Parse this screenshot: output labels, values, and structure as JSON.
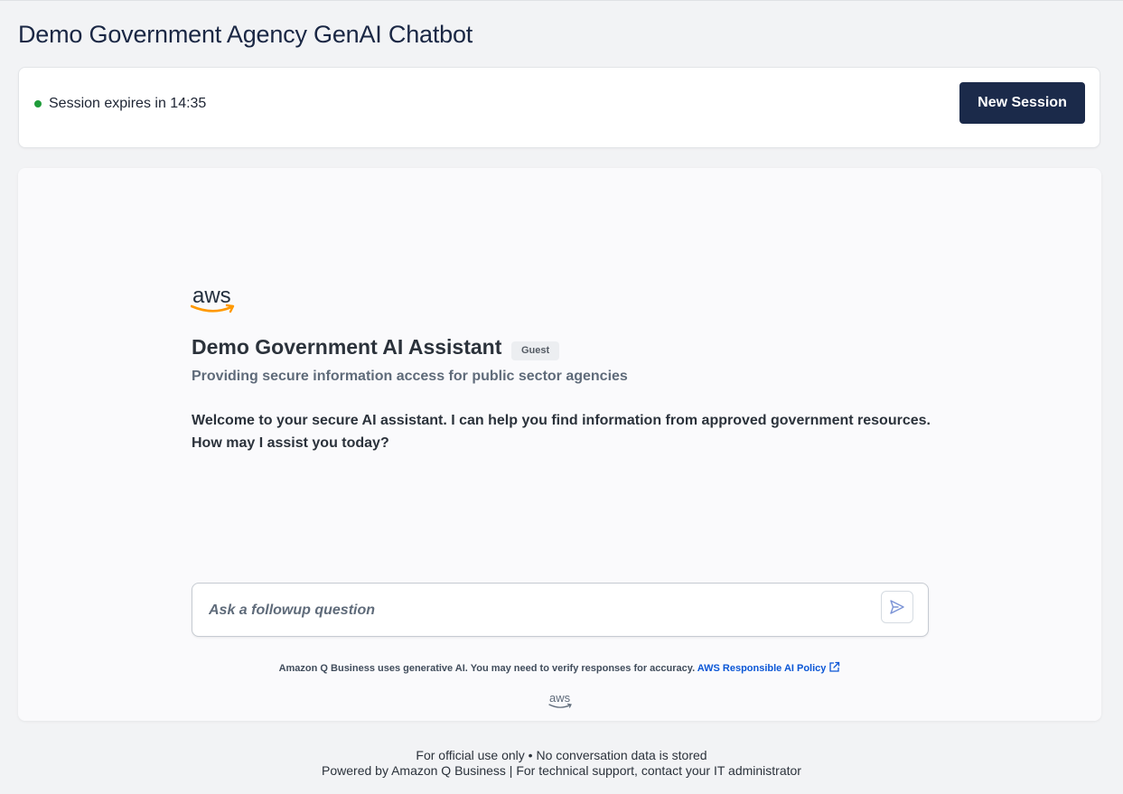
{
  "header": {
    "title": "Demo Government Agency GenAI Chatbot"
  },
  "session": {
    "status_color": "#1f9c3a",
    "expires_text": "Session expires in 14:35",
    "new_session_label": "New Session"
  },
  "chat": {
    "logo_text": "aws",
    "assistant_title": "Demo Government AI Assistant",
    "user_badge": "Guest",
    "subtitle": "Providing secure information access for public sector agencies",
    "welcome_line1": "Welcome to your secure AI assistant. I can help you find information from approved government resources.",
    "welcome_line2": "How may I assist you today?",
    "input_placeholder": "Ask a followup question",
    "send_icon": "send-icon",
    "disclaimer_text": "Amazon Q Business uses generative AI. You may need to verify responses for accuracy.",
    "policy_link_label": "AWS Responsible AI Policy",
    "footer_logo_text": "aws"
  },
  "footer": {
    "line1": "For official use only • No conversation data is stored",
    "line2": "Powered by Amazon Q Business | For technical support, contact your IT administrator"
  },
  "colors": {
    "brand_navy": "#1b2a4a",
    "aws_orange": "#ff9900",
    "link_blue": "#0a56d6"
  }
}
